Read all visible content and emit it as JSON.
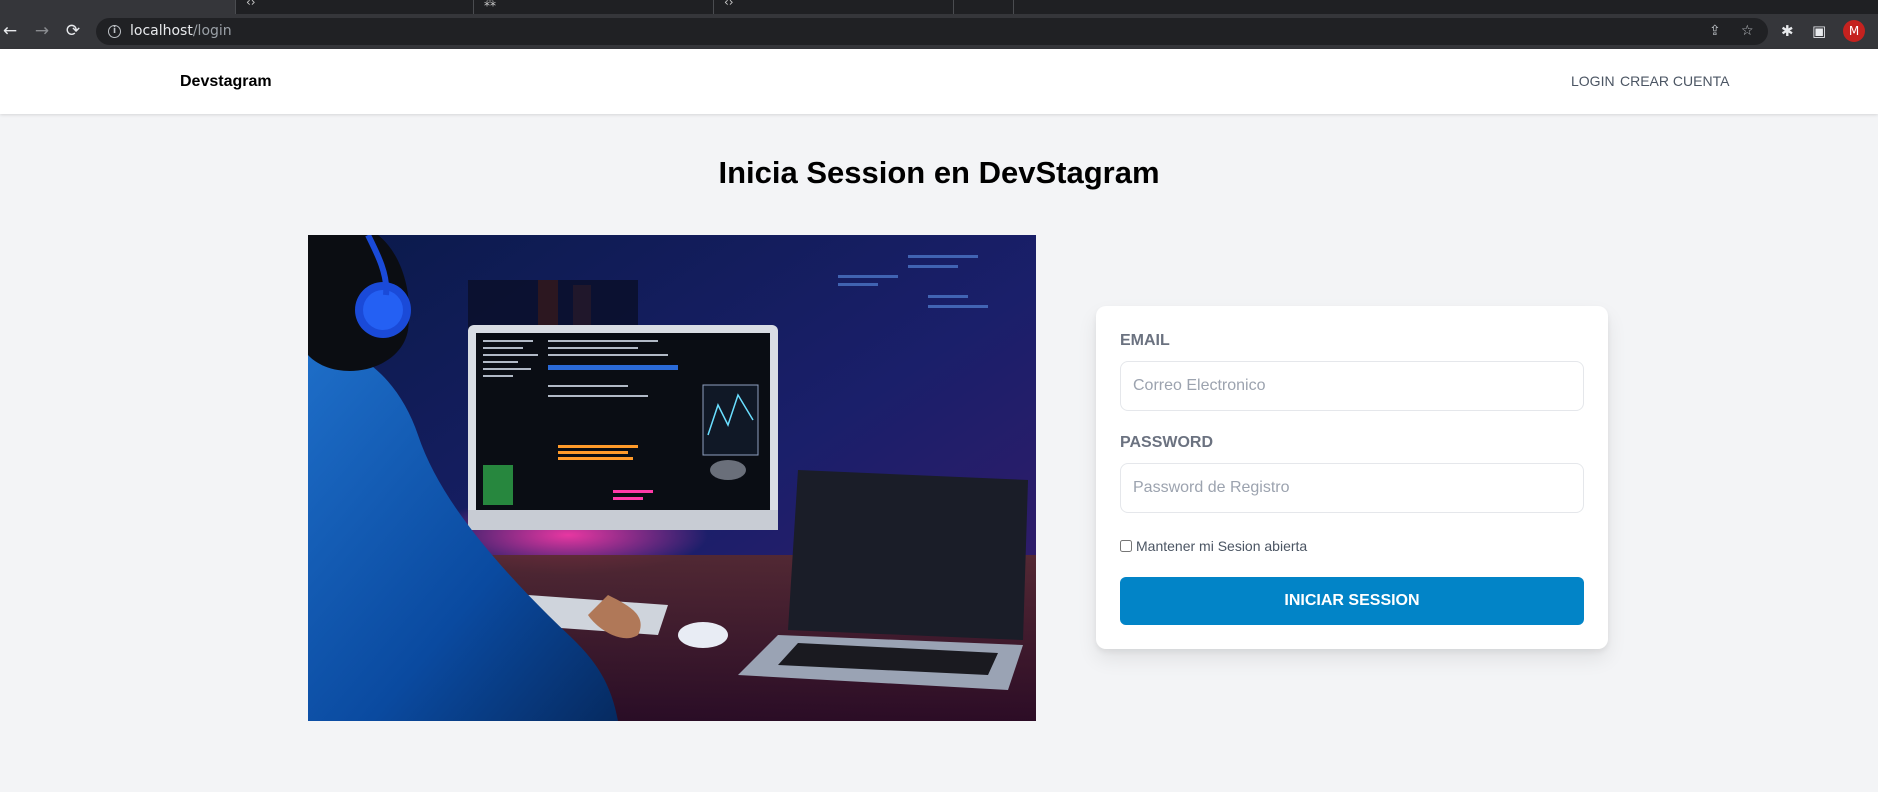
{
  "browser": {
    "url_host": "localhost",
    "url_path": "/login",
    "profile_initial": "M"
  },
  "header": {
    "brand": "Devstagram",
    "nav": [
      {
        "label": "Login"
      },
      {
        "label": "Crear Cuenta"
      }
    ]
  },
  "main": {
    "title": "Inicia Session en DevStagram",
    "form": {
      "email_label": "Email",
      "email_placeholder": "Correo Electronico",
      "password_label": "Password",
      "password_placeholder": "Password de Registro",
      "remember_label": "Mantener mi Sesion abierta",
      "submit_label": "Iniciar Session"
    }
  },
  "colors": {
    "primary": "#0284c7",
    "background": "#f3f4f6"
  }
}
